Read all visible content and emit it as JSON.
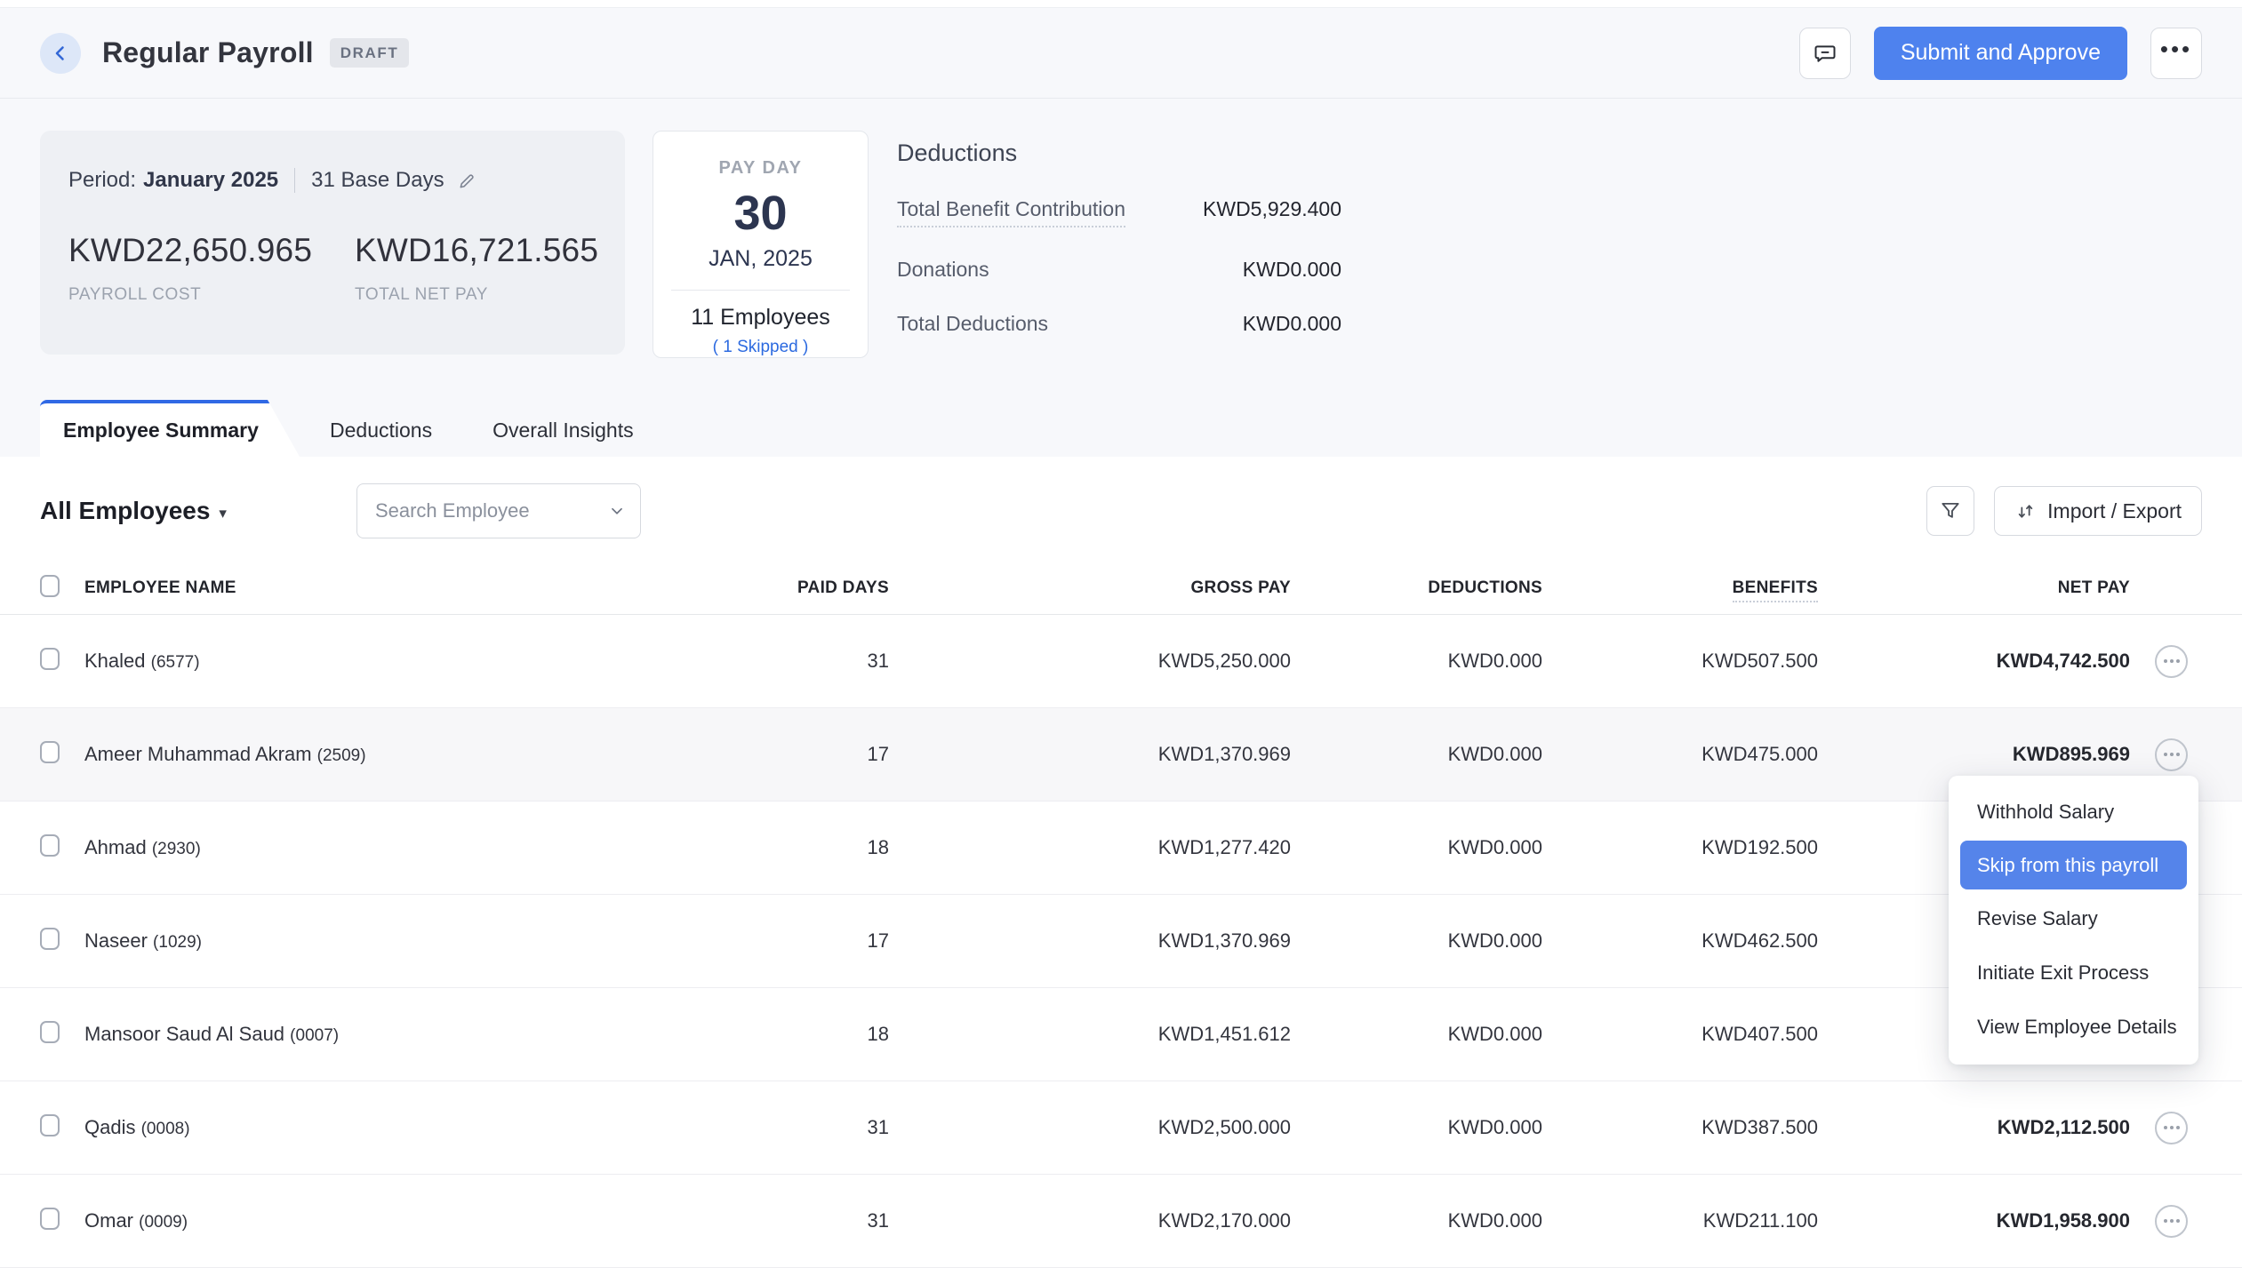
{
  "header": {
    "title": "Regular Payroll",
    "status_badge": "DRAFT",
    "submit_button": "Submit and Approve"
  },
  "summary": {
    "period_label": "Period:",
    "period_value": "January 2025",
    "base_days": "31 Base Days",
    "payroll_cost": "KWD22,650.965",
    "payroll_cost_label": "PAYROLL COST",
    "total_net_pay": "KWD16,721.565",
    "total_net_pay_label": "TOTAL NET PAY"
  },
  "payday": {
    "label": "PAY DAY",
    "day": "30",
    "month_year": "JAN, 2025",
    "employees": "11 Employees",
    "skipped": "( 1 Skipped )"
  },
  "deductions_panel": {
    "title": "Deductions",
    "rows": [
      {
        "label": "Total Benefit Contribution",
        "value": "KWD5,929.400"
      },
      {
        "label": "Donations",
        "value": "KWD0.000"
      },
      {
        "label": "Total Deductions",
        "value": "KWD0.000"
      }
    ]
  },
  "tabs": [
    {
      "label": "Employee Summary"
    },
    {
      "label": "Deductions"
    },
    {
      "label": "Overall Insights"
    }
  ],
  "toolbar": {
    "employee_filter": "All Employees",
    "search_placeholder": "Search Employee",
    "import_export": "Import / Export"
  },
  "table": {
    "columns": [
      "EMPLOYEE NAME",
      "PAID DAYS",
      "GROSS PAY",
      "DEDUCTIONS",
      "BENEFITS",
      "NET PAY"
    ],
    "rows": [
      {
        "name": "Khaled",
        "id": "(6577)",
        "paid_days": "31",
        "gross": "KWD5,250.000",
        "deductions": "KWD0.000",
        "benefits": "KWD507.500",
        "net": "KWD4,742.500"
      },
      {
        "name": "Ameer Muhammad Akram",
        "id": "(2509)",
        "paid_days": "17",
        "gross": "KWD1,370.969",
        "deductions": "KWD0.000",
        "benefits": "KWD475.000",
        "net": "KWD895.969"
      },
      {
        "name": "Ahmad",
        "id": "(2930)",
        "paid_days": "18",
        "gross": "KWD1,277.420",
        "deductions": "KWD0.000",
        "benefits": "KWD192.500",
        "net": ""
      },
      {
        "name": "Naseer",
        "id": "(1029)",
        "paid_days": "17",
        "gross": "KWD1,370.969",
        "deductions": "KWD0.000",
        "benefits": "KWD462.500",
        "net": ""
      },
      {
        "name": "Mansoor Saud Al Saud",
        "id": "(0007)",
        "paid_days": "18",
        "gross": "KWD1,451.612",
        "deductions": "KWD0.000",
        "benefits": "KWD407.500",
        "net": ""
      },
      {
        "name": "Qadis",
        "id": "(0008)",
        "paid_days": "31",
        "gross": "KWD2,500.000",
        "deductions": "KWD0.000",
        "benefits": "KWD387.500",
        "net": "KWD2,112.500"
      },
      {
        "name": "Omar",
        "id": "(0009)",
        "paid_days": "31",
        "gross": "KWD2,170.000",
        "deductions": "KWD0.000",
        "benefits": "KWD211.100",
        "net": "KWD1,958.900"
      }
    ]
  },
  "context_menu": {
    "items": [
      "Withhold Salary",
      "Skip from this payroll",
      "Revise Salary",
      "Initiate Exit Process",
      "View Employee Details"
    ],
    "highlighted": "Skip from this payroll"
  },
  "colors": {
    "accent_blue": "#4e82ee",
    "menu_highlight": "#5584ea",
    "link_blue": "#2c6ae0",
    "tab_border": "#3069e5"
  }
}
